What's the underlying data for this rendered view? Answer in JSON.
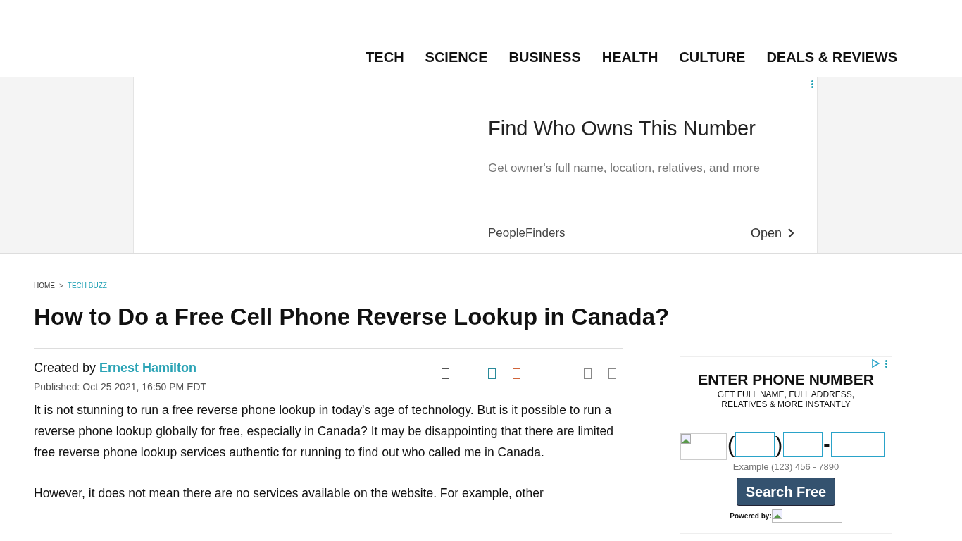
{
  "nav": {
    "items": [
      {
        "label": "TECH"
      },
      {
        "label": "SCIENCE"
      },
      {
        "label": "BUSINESS"
      },
      {
        "label": "HEALTH"
      },
      {
        "label": "CULTURE"
      },
      {
        "label": "DEALS & REVIEWS"
      }
    ]
  },
  "top_ad": {
    "headline": "Find Who Owns This Number",
    "description": "Get owner's full name, location, relatives, and more",
    "advertiser": "PeopleFinders",
    "action": "Open"
  },
  "breadcrumb": [
    {
      "label": "HOME",
      "kind": "plain"
    },
    {
      "label": ">",
      "kind": "separator"
    },
    {
      "label": "TECH BUZZ",
      "kind": "link"
    }
  ],
  "article": {
    "title": "How to Do a Free Cell Phone Reverse Lookup in Canada?",
    "byline_prefix": "Created by",
    "author": "Ernest Hamilton",
    "published": "Published: Oct 25 2021, 16:50 PM EDT",
    "share_icons": [
      {
        "color": "#555555"
      },
      {
        "color": "#2a8a9a"
      },
      {
        "color": "#d0643a"
      },
      {
        "color": "#888888"
      },
      {
        "color": "#888888"
      }
    ],
    "paragraphs": [
      "It is not stunning to run a free reverse phone lookup in today's age of technology. But is it possible to run a reverse phone lookup globally for free, especially in Canada? It may be disappointing that there are limited free reverse phone lookup services authentic for running to find out who called me in Canada.",
      "However, it does not mean there are no services available on the website. For example, other"
    ]
  },
  "side_ad": {
    "heading": "ENTER PHONE NUMBER",
    "subheading": "GET FULL NAME, FULL ADDRESS, RELATIVES & MORE INSTANTLY",
    "open_paren": "(",
    "close_paren": ")",
    "dash": "-",
    "example": "Example (123) 456 - 7890",
    "button": "Search Free",
    "powered_by": "Powered by:"
  }
}
